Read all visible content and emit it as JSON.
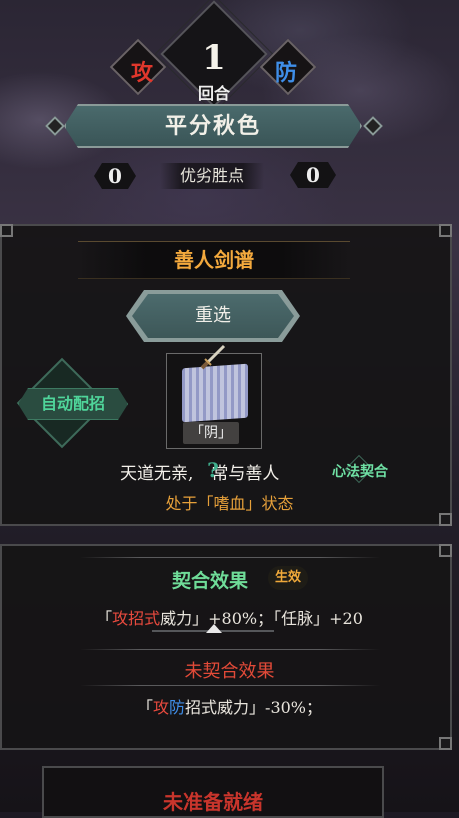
{
  "header": {
    "round_number": "1",
    "round_label": "回合",
    "attack_label": "攻",
    "defense_label": "防",
    "status_banner": "平分秋色",
    "advantage_label": "优劣胜点",
    "left_score": "0",
    "right_score": "0"
  },
  "skill_panel": {
    "title": "善人剑谱",
    "reselect_button": "重选",
    "auto_button": "自动配招",
    "card_tag": "「阴」",
    "line1_a": "天道无亲,",
    "line1_help": "?",
    "line1_b": "常与善人",
    "xinfa_label": "心法契合",
    "line2": "处于「嗜血」状态"
  },
  "effects_panel": {
    "match_title": "契合效果",
    "match_tag": "生效",
    "match_line_open": "「",
    "match_line_atk": "攻招式",
    "match_line_a": "威力」+80%；「任脉」+20",
    "nomatch_title": "未契合效果",
    "nomatch_open": "「",
    "nomatch_atk": "攻",
    "nomatch_def": "防",
    "nomatch_rest": "招式威力」-30%；"
  },
  "bottom": {
    "status": "未准备就绪"
  },
  "colors": {
    "attack": "#e0372c",
    "defense": "#3f8ee8",
    "gold": "#f3a93d",
    "jade": "#4fd59a",
    "teal_button": "#4c6b6d"
  },
  "icons": [
    "sword-icon",
    "help-icon",
    "scroll-icon"
  ]
}
